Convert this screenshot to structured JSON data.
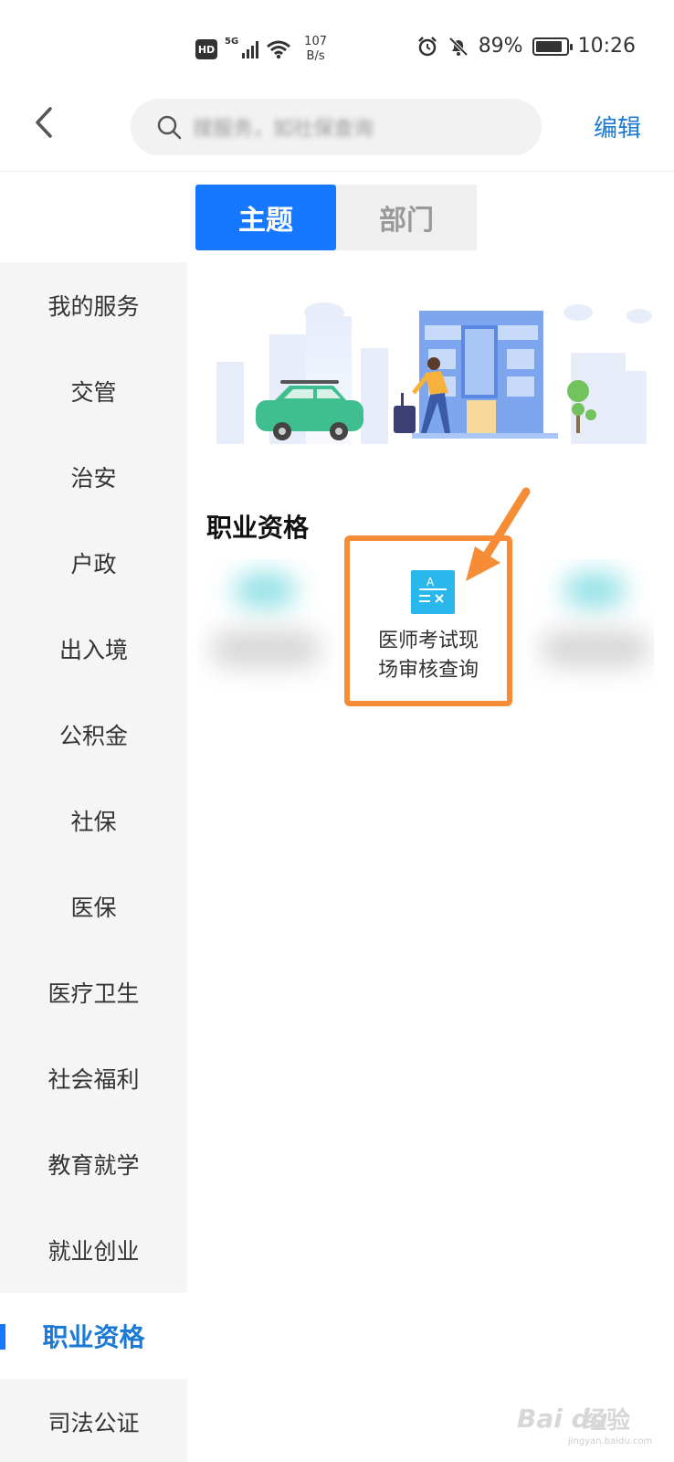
{
  "status_bar": {
    "hd": "HD",
    "network": "5G",
    "speed_value": "107",
    "speed_unit": "B/s",
    "battery": "89%",
    "battery_level": 0.89,
    "time": "10:26"
  },
  "header": {
    "search_placeholder": "搜服务，如社保查询",
    "edit_label": "编辑"
  },
  "tabs": [
    {
      "label": "主题",
      "active": true
    },
    {
      "label": "部门",
      "active": false
    }
  ],
  "sidebar": {
    "items": [
      {
        "label": "我的服务"
      },
      {
        "label": "交管"
      },
      {
        "label": "治安"
      },
      {
        "label": "户政"
      },
      {
        "label": "出入境"
      },
      {
        "label": "公积金"
      },
      {
        "label": "社保"
      },
      {
        "label": "医保"
      },
      {
        "label": "医疗卫生"
      },
      {
        "label": "社会福利"
      },
      {
        "label": "教育就学"
      },
      {
        "label": "就业创业"
      },
      {
        "label": "职业资格",
        "active": true
      },
      {
        "label": "司法公证"
      }
    ]
  },
  "main": {
    "section_title": "职业资格",
    "service": {
      "label_line1": "医师考试现",
      "label_line2": "场审核查询",
      "icon": "exam-formula-icon"
    }
  },
  "watermark": {
    "brand": "Bai du",
    "sub": "经验",
    "url": "jingyan.baidu.com"
  },
  "colors": {
    "primary": "#1677ff",
    "link": "#1a7ad6",
    "highlight": "#f78c36",
    "icon_bg": "#29b7ec"
  }
}
